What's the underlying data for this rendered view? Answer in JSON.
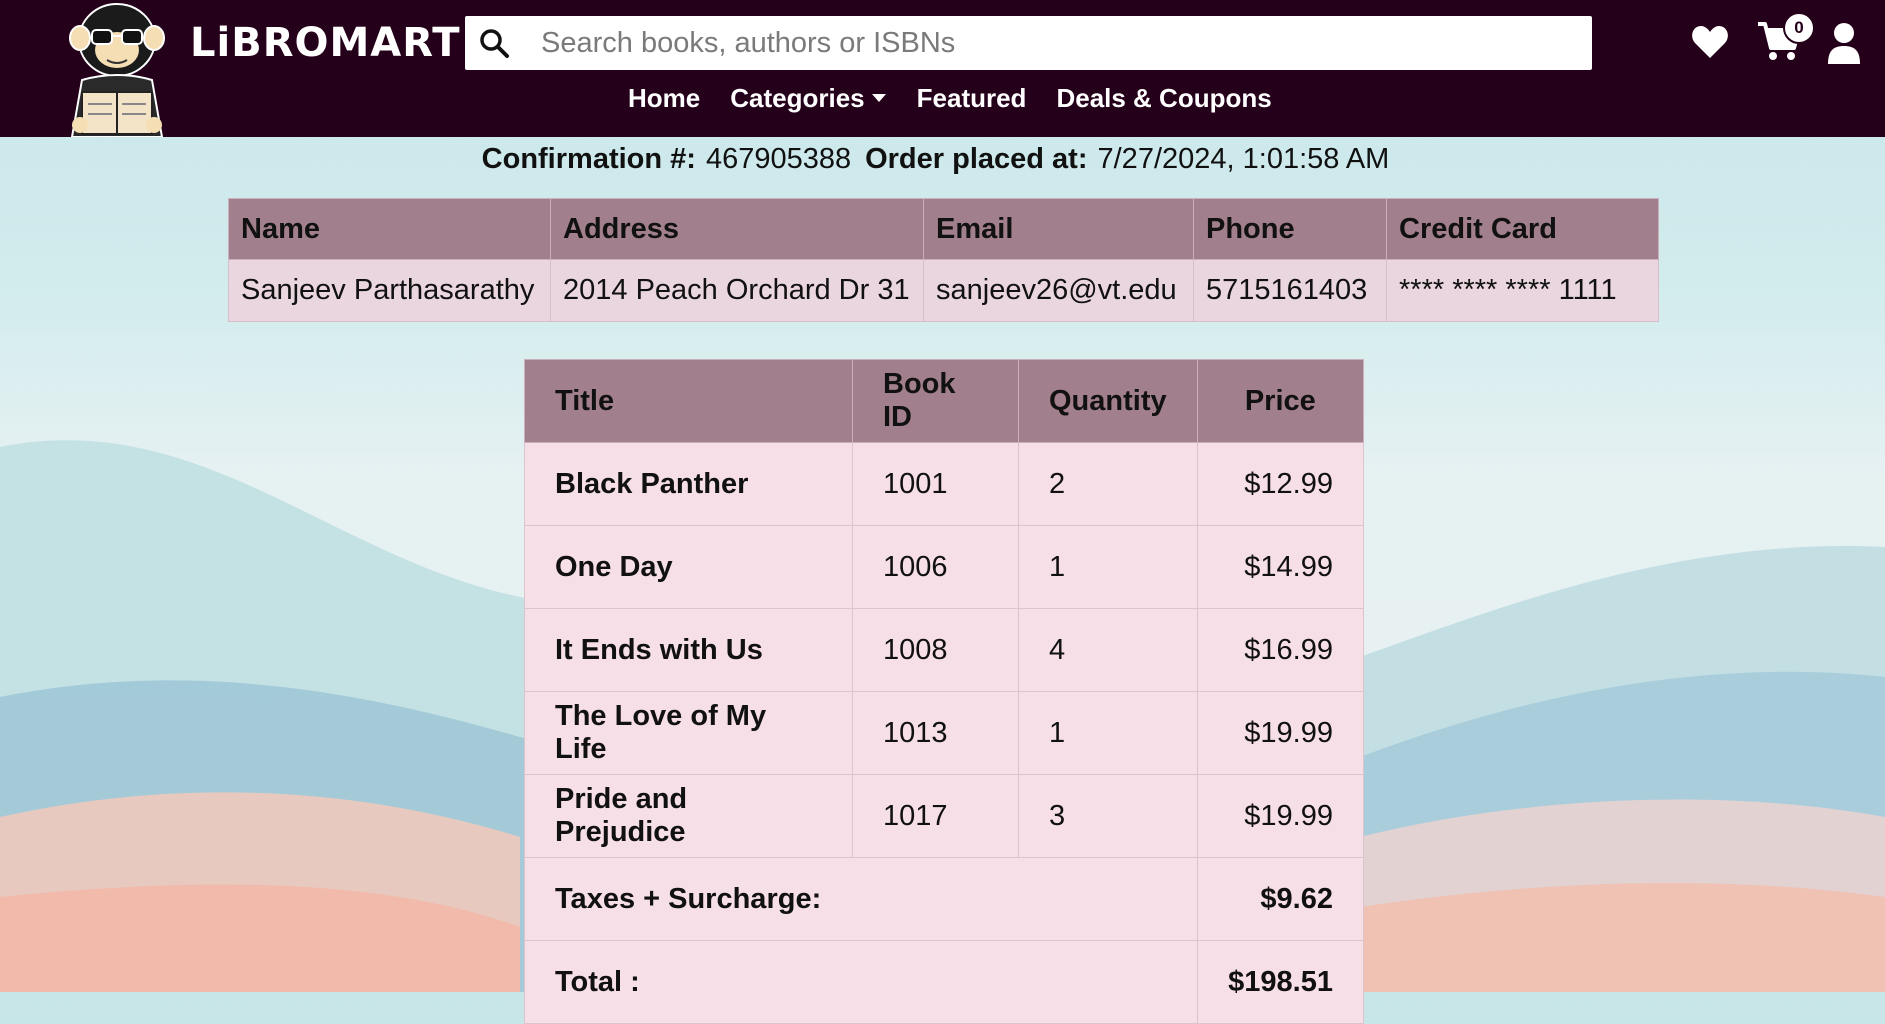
{
  "header": {
    "logo_text": "LiBROMART",
    "search_placeholder": "Search books, authors or ISBNs",
    "search_value": "",
    "nav": {
      "home": "Home",
      "categories": "Categories",
      "featured": "Featured",
      "deals": "Deals & Coupons"
    },
    "cart_count": "0",
    "icons": [
      "search-icon",
      "heart-icon",
      "cart-icon",
      "user-icon",
      "chevron-down-icon"
    ]
  },
  "confirmation": {
    "number_label": "Confirmation #:",
    "number_value": "467905388",
    "placed_label": "Order placed at:",
    "placed_value": "7/27/2024, 1:01:58 AM"
  },
  "customer": {
    "headers": [
      "Name",
      "Address",
      "Email",
      "Phone",
      "Credit Card"
    ],
    "row": [
      "Sanjeev Parthasarathy",
      "2014 Peach Orchard Dr 31",
      "sanjeev26@vt.edu",
      "5715161403",
      "**** **** **** 1111"
    ]
  },
  "order": {
    "headers": [
      "Title",
      "Book ID",
      "Quantity",
      "Price"
    ],
    "items": [
      {
        "title": "Black Panther",
        "book_id": "1001",
        "quantity": "2",
        "price": "$12.99"
      },
      {
        "title": "One Day",
        "book_id": "1006",
        "quantity": "1",
        "price": "$14.99"
      },
      {
        "title": "It Ends with Us",
        "book_id": "1008",
        "quantity": "4",
        "price": "$16.99"
      },
      {
        "title": "The Love of My Life",
        "book_id": "1013",
        "quantity": "1",
        "price": "$19.99"
      },
      {
        "title": "Pride and Prejudice",
        "book_id": "1017",
        "quantity": "3",
        "price": "$19.99"
      }
    ],
    "taxes_label": "Taxes + Surcharge:",
    "taxes_value": "$9.62",
    "total_label": "Total :",
    "total_value": "$198.51"
  },
  "colors": {
    "header_bg": "#25001a",
    "table_header_bg": "#a27f8c",
    "table_row_bg": "#f6dfe7",
    "customer_row_bg": "#ead6df"
  }
}
